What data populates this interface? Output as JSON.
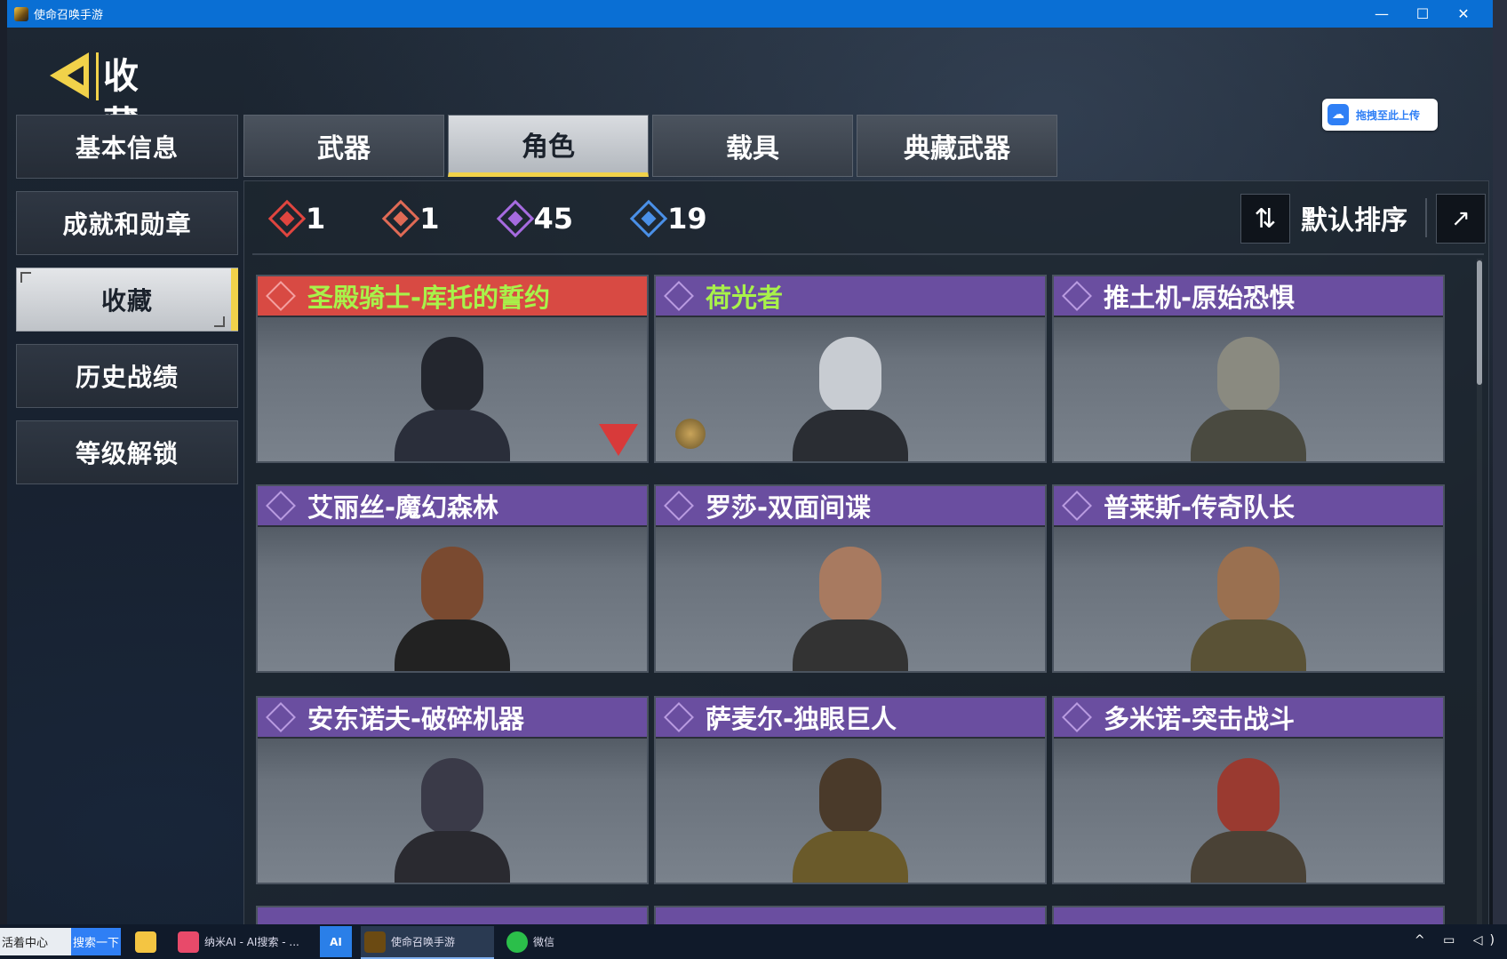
{
  "window": {
    "title": "使命召唤手游",
    "minimize": "—",
    "maximize": "☐",
    "close": "✕"
  },
  "header": {
    "title": "收藏"
  },
  "upload": {
    "label": "拖拽至此上传"
  },
  "nav": {
    "items": [
      {
        "label": "基本信息",
        "active": false
      },
      {
        "label": "成就和勋章",
        "active": false
      },
      {
        "label": "收藏",
        "active": true
      },
      {
        "label": "历史战绩",
        "active": false
      },
      {
        "label": "等级解锁",
        "active": false
      }
    ]
  },
  "tabs": [
    {
      "label": "武器",
      "active": false
    },
    {
      "label": "角色",
      "active": true
    },
    {
      "label": "载具",
      "active": false
    },
    {
      "label": "典藏武器",
      "active": false
    }
  ],
  "stats": [
    {
      "rarity": "mythic",
      "count": "1",
      "color": "#e0453f"
    },
    {
      "rarity": "legendary",
      "count": "1",
      "color": "#e06a55"
    },
    {
      "rarity": "epic",
      "count": "45",
      "color": "#a66be0"
    },
    {
      "rarity": "rare",
      "count": "19",
      "color": "#4a90e8"
    }
  ],
  "sort": {
    "label": "默认排序",
    "toggle_icon": "sort-toggle-icon",
    "share_icon": "share-icon"
  },
  "cards": [
    {
      "name": "圣殿骑士-库托的誓约",
      "rarity": "legendary",
      "name_color": "green"
    },
    {
      "name": "荷光者",
      "rarity": "epic",
      "name_color": "green"
    },
    {
      "name": "推土机-原始恐惧",
      "rarity": "epic",
      "name_color": "white"
    },
    {
      "name": "艾丽丝-魔幻森林",
      "rarity": "epic",
      "name_color": "white"
    },
    {
      "name": "罗莎-双面间谍",
      "rarity": "epic",
      "name_color": "white"
    },
    {
      "name": "普莱斯-传奇队长",
      "rarity": "epic",
      "name_color": "white"
    },
    {
      "name": "安东诺夫-破碎机器",
      "rarity": "epic",
      "name_color": "white"
    },
    {
      "name": "萨麦尔-独眼巨人",
      "rarity": "epic",
      "name_color": "white"
    },
    {
      "name": "多米诺-突击战斗",
      "rarity": "epic",
      "name_color": "white"
    }
  ],
  "taskbar": {
    "search_text": "活着中心",
    "search_button": "搜索一下",
    "tasks": [
      {
        "label": "纳米AI - AI搜索 - ..."
      },
      {
        "label": "AI"
      },
      {
        "label": "使命召唤手游"
      },
      {
        "label": "微信"
      }
    ],
    "tray": "^ ▭ ◁)"
  }
}
